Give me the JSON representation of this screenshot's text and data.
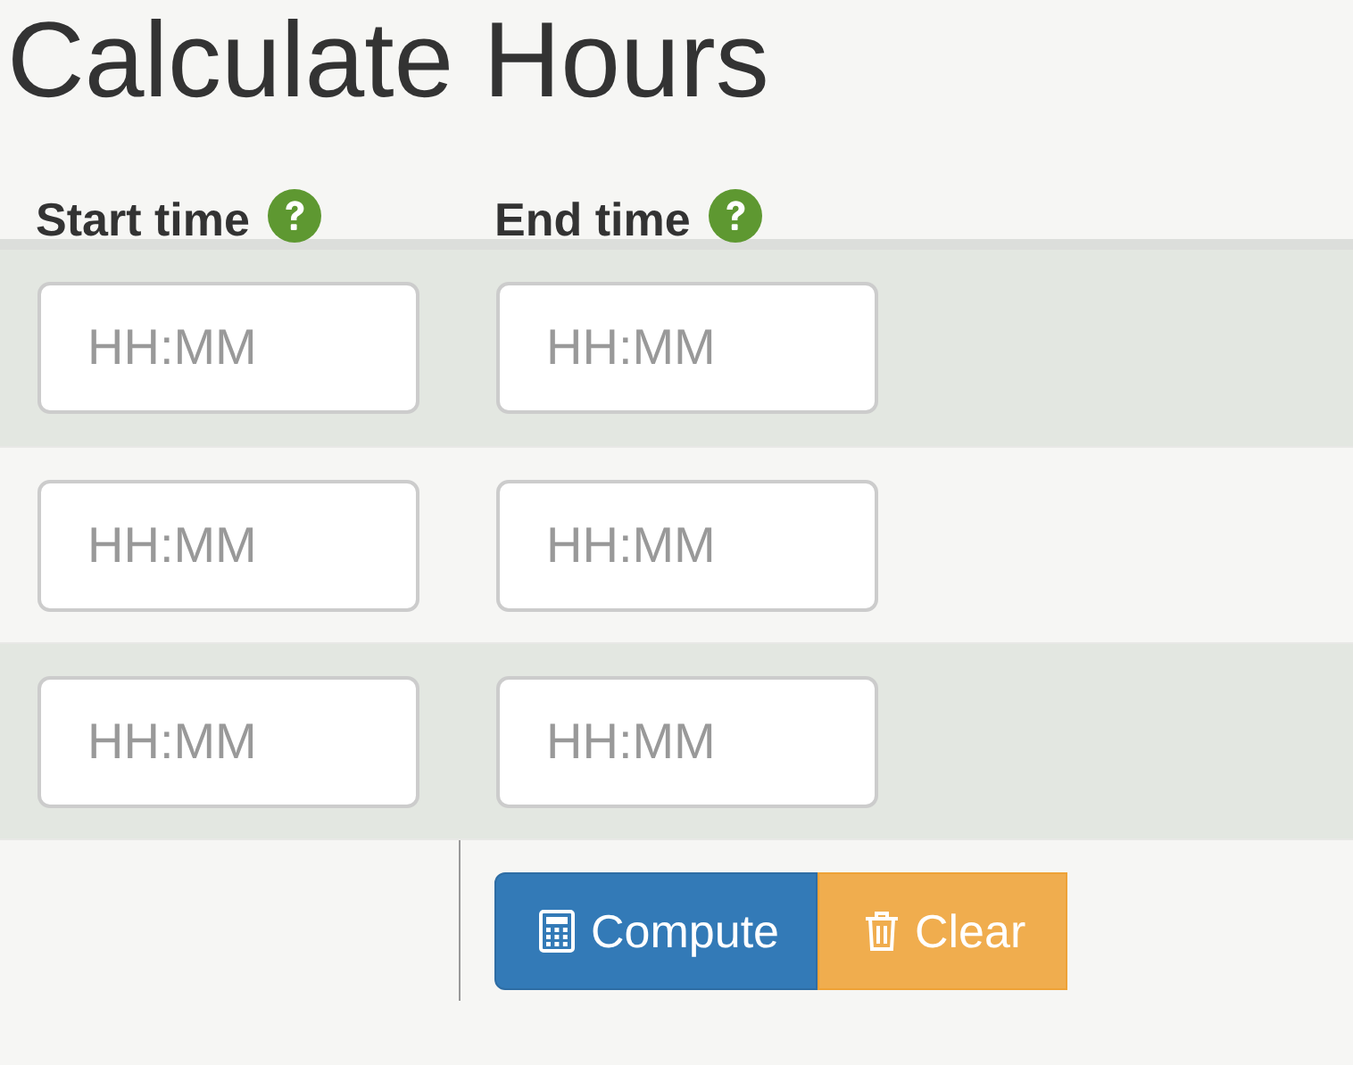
{
  "title": "Calculate Hours",
  "columns": [
    {
      "label": "Start time"
    },
    {
      "label": "End time"
    }
  ],
  "rows": [
    {
      "start": {
        "placeholder": "HH:MM"
      },
      "end": {
        "placeholder": "HH:MM"
      }
    },
    {
      "start": {
        "placeholder": "HH:MM"
      },
      "end": {
        "placeholder": "HH:MM"
      }
    },
    {
      "start": {
        "placeholder": "HH:MM"
      },
      "end": {
        "placeholder": "HH:MM"
      }
    }
  ],
  "buttons": [
    {
      "kind": "compute",
      "label": "Compute"
    },
    {
      "kind": "clear",
      "label": "Clear"
    }
  ]
}
